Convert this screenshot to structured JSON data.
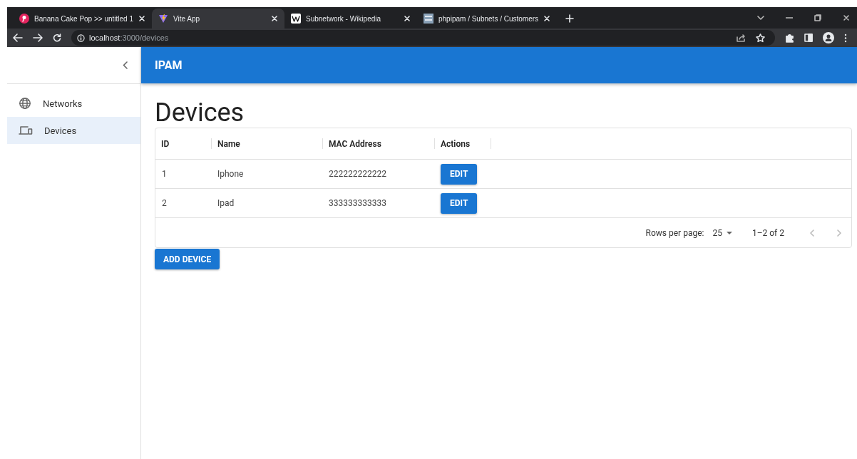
{
  "browser": {
    "tabs": [
      {
        "title": "Banana Cake Pop >> untitled 1",
        "selected": false
      },
      {
        "title": "Vite App",
        "selected": true
      },
      {
        "title": "Subnetwork - Wikipedia",
        "selected": false
      },
      {
        "title": "phpipam / Subnets / Customers",
        "selected": false
      }
    ],
    "url_host": "localhost",
    "url_rest": ":3000/devices"
  },
  "app": {
    "title": "IPAM",
    "sidebar": {
      "items": [
        {
          "label": "Networks",
          "selected": false
        },
        {
          "label": "Devices",
          "selected": true
        }
      ]
    },
    "page_title": "Devices",
    "table": {
      "columns": [
        "ID",
        "Name",
        "MAC Address",
        "Actions"
      ],
      "rows": [
        {
          "id": "1",
          "name": "Iphone",
          "mac": "222222222222",
          "action": "EDIT"
        },
        {
          "id": "2",
          "name": "Ipad",
          "mac": "333333333333",
          "action": "EDIT"
        }
      ],
      "footer": {
        "rows_per_page_label": "Rows per page:",
        "rows_per_page": "25",
        "range": "1–2 of 2"
      }
    },
    "add_button": "ADD DEVICE"
  }
}
